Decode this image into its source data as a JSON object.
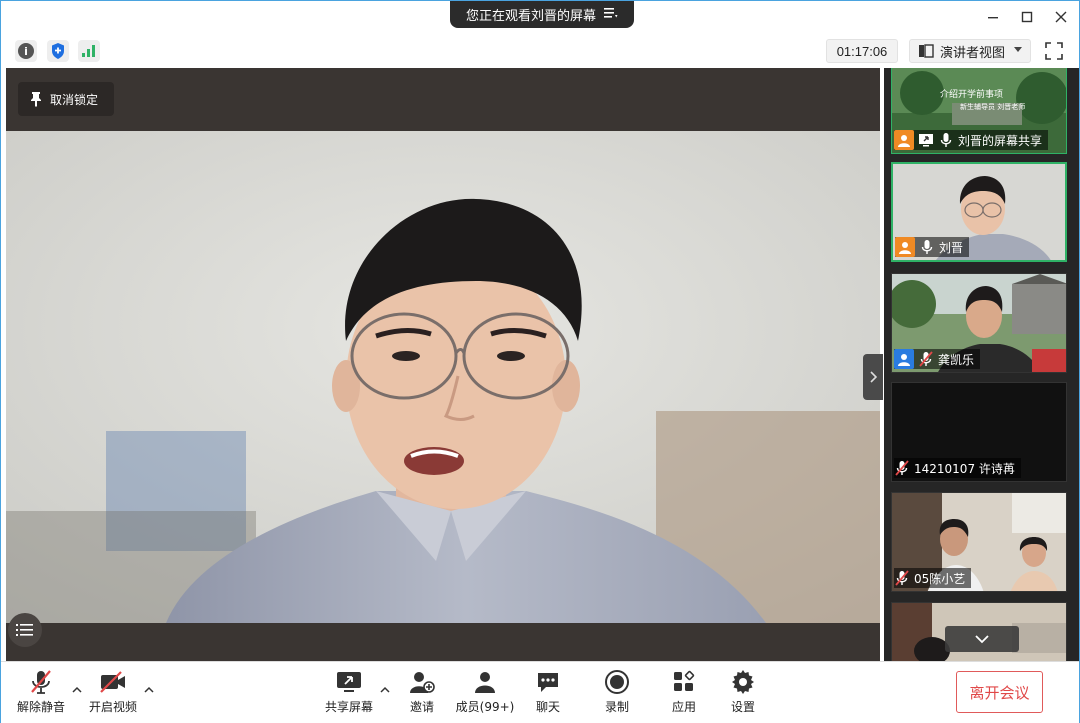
{
  "banner": {
    "text": "您正在观看刘晋的屏幕"
  },
  "toolbar": {
    "timer": "01:17:06",
    "view_mode": "演讲者视图"
  },
  "main": {
    "unlock_label": "取消锁定"
  },
  "participants": [
    {
      "name": "刘晋的屏幕共享",
      "share_text_1": "介绍开学前事项",
      "share_text_2": "新生辅导员  刘晋老师"
    },
    {
      "name": "刘晋"
    },
    {
      "name": "龚凯乐"
    },
    {
      "name": "14210107 许诗苒"
    },
    {
      "name": "05陈小艺"
    }
  ],
  "bottom": {
    "unmute": "解除静音",
    "start_video": "开启视频",
    "share_screen": "共享屏幕",
    "invite": "邀请",
    "members": "成员(99+)",
    "chat": "聊天",
    "record": "录制",
    "apps": "应用",
    "settings": "设置",
    "leave": "离开会议"
  },
  "colors": {
    "accent_green": "#2fb266",
    "leave_red": "#e04848",
    "muted_red": "#e04848"
  }
}
